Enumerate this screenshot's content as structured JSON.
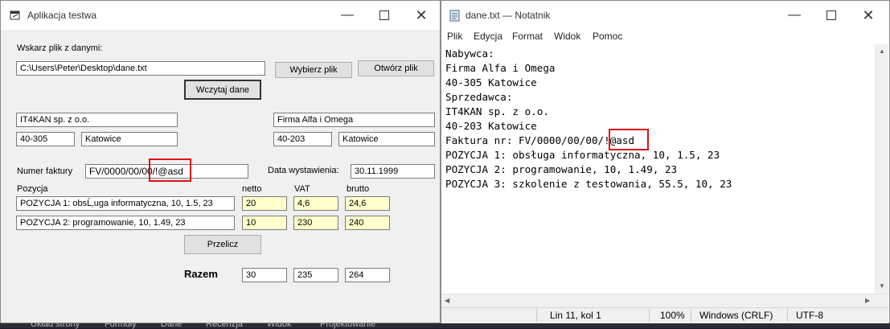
{
  "app": {
    "title": "Aplikacja testwa",
    "file_label": "Wskarz plik z danymi:",
    "file_path": "C:\\Users\\Peter\\Desktop\\dane.txt",
    "btn_choose": "Wybierz plik",
    "btn_open": "Otwórz plik",
    "btn_load": "Wczytaj dane",
    "seller": {
      "name": "IT4KAN sp. z o.o.",
      "zip": "40-305",
      "city": "Katowice"
    },
    "buyer": {
      "name": "Firma Alfa i Omega",
      "zip": "40-203",
      "city": "Katowice"
    },
    "invoice_label": "Numer faktury",
    "invoice_number": "FV/0000/00/00/!@asd",
    "date_label": "Data wystawienia:",
    "date_value": "30.11.1999",
    "col_pozycja": "Pozycja",
    "col_netto": "netto",
    "col_vat": "VAT",
    "col_brutto": "brutto",
    "rows": [
      {
        "desc": "POZYCJA 1: obsĹ‚uga informatyczna, 10, 1.5, 23",
        "netto": "20",
        "vat": "4,6",
        "brutto": "24,6"
      },
      {
        "desc": "POZYCJA 2: programowanie, 10, 1.49, 23",
        "netto": "10",
        "vat": "230",
        "brutto": "240"
      }
    ],
    "btn_calc": "Przelicz",
    "total_label": "Razem",
    "total": {
      "netto": "30",
      "vat": "235",
      "brutto": "264"
    }
  },
  "notepad": {
    "title": "dane.txt — Notatnik",
    "menu": [
      "Plik",
      "Edycja",
      "Format",
      "Widok",
      "Pomoc"
    ],
    "lines": [
      "Nabywca:",
      "Firma Alfa i Omega",
      "40-305 Katowice",
      "Sprzedawca:",
      "IT4KAN sp. z o.o.",
      "40-203 Katowice",
      "Faktura nr: FV/0000/00/00/!@asd",
      "POZYCJA 1: obsługa informatyczna, 10, 1.5, 23",
      "POZYCJA 2: programowanie, 10, 1.49, 23",
      "POZYCJA 3: szkolenie z testowania, 55.5, 10, 23"
    ],
    "status": {
      "position": "Lin 11, kol 1",
      "zoom": "100%",
      "eol": "Windows (CRLF)",
      "encoding": "UTF-8"
    }
  },
  "background_tabs": [
    "Układ strony",
    "Formuły",
    "Dane",
    "Recenzja",
    "Widok",
    "Projektowanie"
  ],
  "colors": {
    "highlight": "#e01010",
    "readonly_field": "#ffffcc"
  }
}
